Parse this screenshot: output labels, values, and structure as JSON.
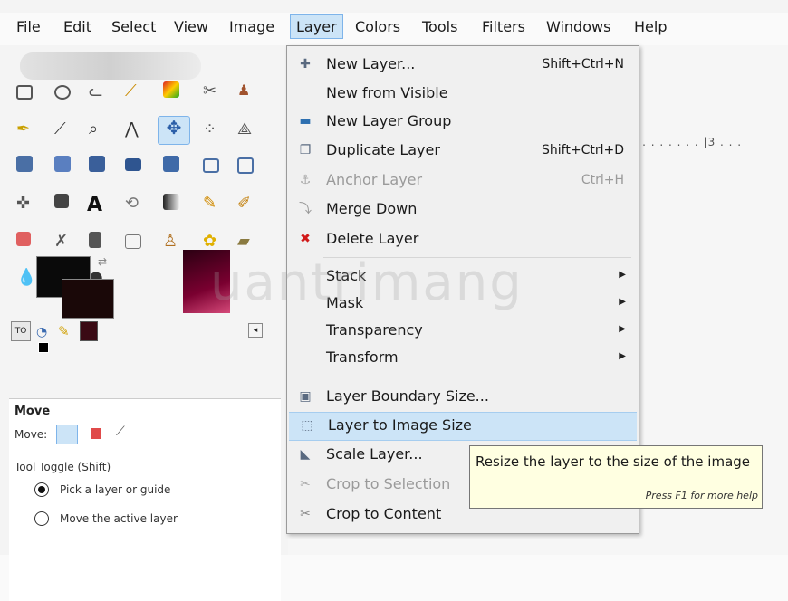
{
  "menubar": {
    "items": [
      "File",
      "Edit",
      "Select",
      "View",
      "Image",
      "Layer",
      "Colors",
      "Tools",
      "Filters",
      "Windows",
      "Help"
    ],
    "active": "Layer"
  },
  "layer_menu": {
    "items": [
      {
        "label": "New Layer...",
        "shortcut": "Shift+Ctrl+N",
        "icon": "new-layer-icon",
        "glyph": "✚"
      },
      {
        "label": "New from Visible",
        "shortcut": "",
        "icon": "",
        "glyph": ""
      },
      {
        "label": "New Layer Group",
        "shortcut": "",
        "icon": "folder-icon",
        "glyph": "▬"
      },
      {
        "label": "Duplicate Layer",
        "shortcut": "Shift+Ctrl+D",
        "icon": "duplicate-icon",
        "glyph": "❐"
      },
      {
        "label": "Anchor Layer",
        "shortcut": "Ctrl+H",
        "icon": "anchor-icon",
        "glyph": "⚓"
      },
      {
        "label": "Merge Down",
        "shortcut": "",
        "icon": "merge-icon",
        "glyph": "⤵"
      },
      {
        "label": "Delete Layer",
        "shortcut": "",
        "icon": "delete-icon",
        "glyph": "✖"
      },
      {
        "label": "Stack",
        "shortcut": "",
        "icon": "",
        "glyph": ""
      },
      {
        "label": "Mask",
        "shortcut": "",
        "icon": "",
        "glyph": ""
      },
      {
        "label": "Transparency",
        "shortcut": "",
        "icon": "",
        "glyph": ""
      },
      {
        "label": "Transform",
        "shortcut": "",
        "icon": "",
        "glyph": ""
      },
      {
        "label": "Layer Boundary Size...",
        "shortcut": "",
        "icon": "boundary-icon",
        "glyph": "▣"
      },
      {
        "label": "Layer to Image Size",
        "shortcut": "",
        "icon": "layer-to-image-icon",
        "glyph": "⬚"
      },
      {
        "label": "Scale Layer...",
        "shortcut": "",
        "icon": "scale-icon",
        "glyph": "◣"
      },
      {
        "label": "Crop to Selection",
        "shortcut": "",
        "icon": "crop-icon",
        "glyph": "✂"
      },
      {
        "label": "Crop to Content",
        "shortcut": "",
        "icon": "crop-content-icon",
        "glyph": "✂"
      }
    ],
    "submenu_arrow": "▶"
  },
  "tooltip": {
    "text": "Resize the layer to the size of the image",
    "hint": "Press F1 for more help"
  },
  "tool_options": {
    "title": "Move",
    "move_label": "Move:",
    "toggle_label": "Tool Toggle  (Shift)",
    "option1": "Pick a layer or guide",
    "option2": "Move the active layer"
  },
  "ruler": {
    "text": "ⅰ . . . . . . . |3 . . ."
  },
  "watermark": "uantrimang",
  "colors": {
    "accent": "#cce4f7",
    "highlight_border": "#7eb4ea",
    "delete": "#d11a1a"
  }
}
